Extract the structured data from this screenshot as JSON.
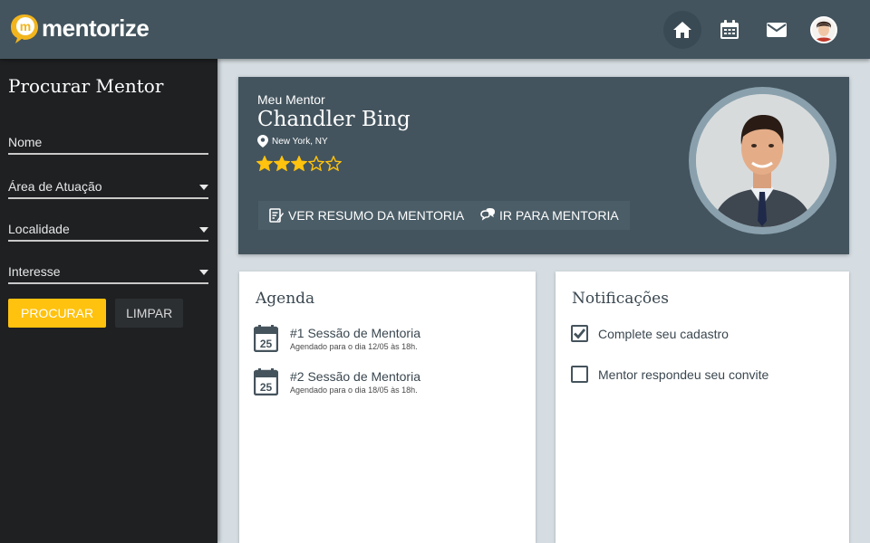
{
  "app": {
    "logo_text": "mentorize",
    "logo_letter": "m"
  },
  "nav": {
    "icons": [
      "home-icon",
      "calendar-icon",
      "mail-icon",
      "user-avatar"
    ]
  },
  "sidebar": {
    "title": "Procurar Mentor",
    "fields": [
      {
        "label": "Nome",
        "type": "text"
      },
      {
        "label": "Área de Atuação",
        "type": "select"
      },
      {
        "label": "Localidade",
        "type": "select"
      },
      {
        "label": "Interesse",
        "type": "select"
      }
    ],
    "search_label": "PROCURAR",
    "clear_label": "LIMPAR"
  },
  "mentor": {
    "heading": "Meu Mentor",
    "name": "Chandler Bing",
    "location": "New York, NY",
    "rating": 3,
    "rating_max": 5,
    "summary_button": "VER RESUMO DA MENTORIA",
    "go_button": "IR PARA MENTORIA"
  },
  "agenda": {
    "title": "Agenda",
    "items": [
      {
        "day": "25",
        "title": "#1 Sessão de Mentoria",
        "subtitle": "Agendado para o dia 12/05 às 18h."
      },
      {
        "day": "25",
        "title": "#2 Sessão de Mentoria",
        "subtitle": "Agendado para o dia 18/05 às 18h."
      }
    ]
  },
  "notifications": {
    "title": "Notificações",
    "items": [
      {
        "text": "Complete seu cadastro",
        "checked": true
      },
      {
        "text": "Mentor respondeu seu convite",
        "checked": false
      }
    ]
  },
  "colors": {
    "topbar": "#43545e",
    "sidebar": "#1e2022",
    "accent": "#ffc20e",
    "star": "#ffc20e"
  }
}
